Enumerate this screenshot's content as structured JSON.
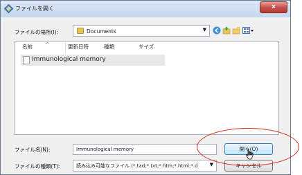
{
  "window": {
    "title": "ファイルを開く",
    "close_label": "x"
  },
  "location": {
    "label": "ファイルの場所(I):",
    "folder": "Documents"
  },
  "list": {
    "columns": [
      "名前",
      "更新日時",
      "種類",
      "サイズ"
    ],
    "items": [
      {
        "name": "Immunological memory"
      }
    ]
  },
  "filename": {
    "label": "ファイル名(N):",
    "value": "Immunological memory"
  },
  "filetype": {
    "label": "ファイルの種類(T):",
    "value": "読み込み可能なファイル (*.tad;*.txt;*.htm;*.html;*.d"
  },
  "buttons": {
    "open": "開く(O)",
    "cancel": "キャンセル"
  },
  "colors": {
    "annotation": "#d62a1e",
    "accent": "#3c7fb1"
  }
}
